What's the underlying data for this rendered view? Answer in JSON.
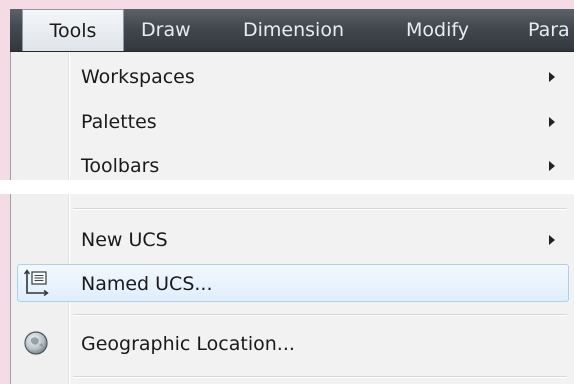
{
  "menubar": {
    "items": [
      {
        "label": "Tools",
        "active": true
      },
      {
        "label": "Draw"
      },
      {
        "label": "Dimension"
      },
      {
        "label": "Modify"
      },
      {
        "label": "Para"
      }
    ]
  },
  "menu": {
    "items": [
      {
        "label": "Workspaces",
        "submenu": true
      },
      {
        "label": "Palettes",
        "submenu": true
      },
      {
        "label": "Toolbars",
        "submenu": true
      },
      {
        "label": "New UCS",
        "submenu": true
      },
      {
        "label": "Named UCS...",
        "icon": "named-ucs-icon",
        "highlighted": true
      },
      {
        "label": "Geographic Location...",
        "icon": "globe-icon"
      }
    ]
  },
  "colors": {
    "menubar_bg": "#43484f",
    "menu_bg": "#f2f2f2",
    "highlight_border": "#aecff2",
    "page_bg": "#f5dbe4"
  }
}
